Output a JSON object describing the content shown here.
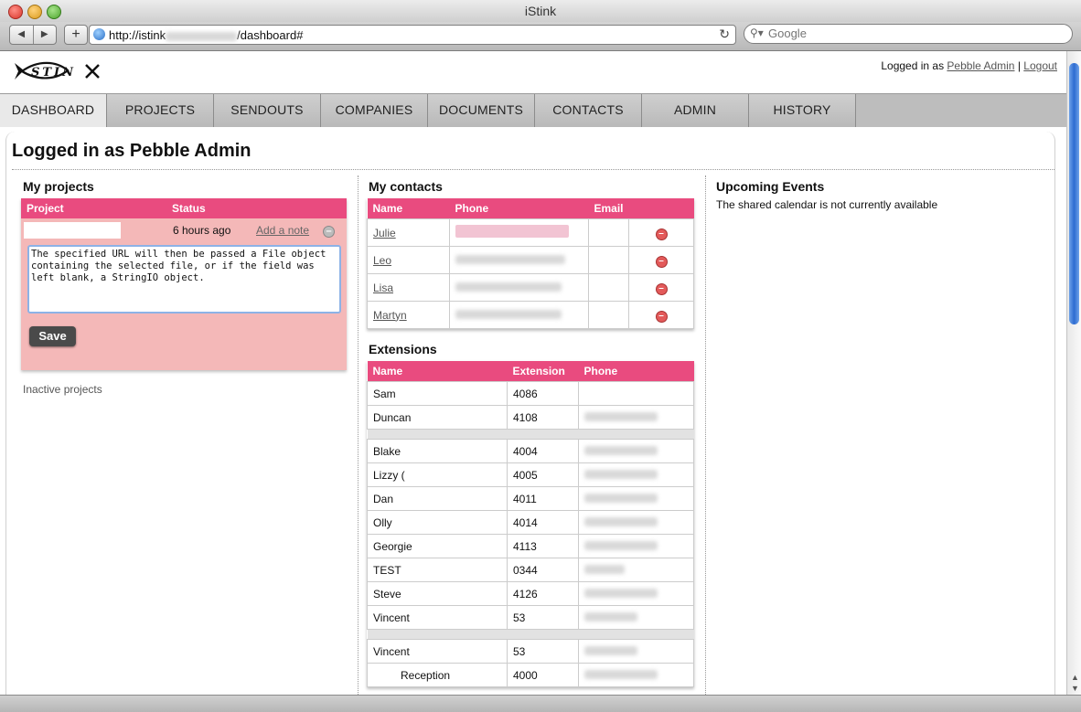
{
  "window": {
    "title": "iStink"
  },
  "browser": {
    "url_prefix": "http://istink",
    "url_suffix": "/dashboard#",
    "search_placeholder": "Google"
  },
  "header": {
    "logged_in_prefix": "Logged in as",
    "user_link": "Pebble Admin",
    "separator": "|",
    "logout": "Logout"
  },
  "tabs": [
    "DASHBOARD",
    "PROJECTS",
    "SENDOUTS",
    "COMPANIES",
    "DOCUMENTS",
    "CONTACTS",
    "ADMIN",
    "HISTORY"
  ],
  "active_tab": "DASHBOARD",
  "page_title": "Logged in as Pebble Admin",
  "projects": {
    "heading": "My projects",
    "col_project": "Project",
    "col_status": "Status",
    "status_value": "6 hours ago",
    "add_note": "Add a note",
    "note_text": "The specified URL will then be passed a File object containing the selected file, or if the field was left blank, a StringIO object.",
    "save_label": "Save",
    "inactive_link": "Inactive projects"
  },
  "contacts": {
    "heading": "My contacts",
    "columns": [
      "Name",
      "Phone",
      "Email"
    ],
    "rows": [
      {
        "name": "Julie"
      },
      {
        "name": "Leo"
      },
      {
        "name": "Lisa"
      },
      {
        "name": "Martyn"
      }
    ]
  },
  "extensions": {
    "heading": "Extensions",
    "columns": [
      "Name",
      "Extension",
      "Phone"
    ],
    "rows": [
      {
        "name": "Sam",
        "ext": "4086"
      },
      {
        "name": "Duncan",
        "ext": "4108"
      },
      {
        "sep": true
      },
      {
        "name": "Blake",
        "ext": "4004"
      },
      {
        "name": "Lizzy (",
        "ext": "4005"
      },
      {
        "name": "Dan",
        "ext": "4011"
      },
      {
        "name": "Olly",
        "ext": "4014"
      },
      {
        "name": "Georgie",
        "ext": "4113"
      },
      {
        "name": "TEST",
        "ext": "0344"
      },
      {
        "name": "Steve",
        "ext": "4126"
      },
      {
        "name": "Vincent",
        "ext": "53"
      },
      {
        "sep": true
      },
      {
        "name": "Vincent",
        "ext": "53"
      },
      {
        "name": "Reception",
        "ext": "4000",
        "indent": true
      }
    ]
  },
  "events": {
    "heading": "Upcoming Events",
    "message": "The shared calendar is not currently available"
  },
  "colors": {
    "accent": "#e94b7f",
    "project_bg": "#f4b8b8"
  }
}
